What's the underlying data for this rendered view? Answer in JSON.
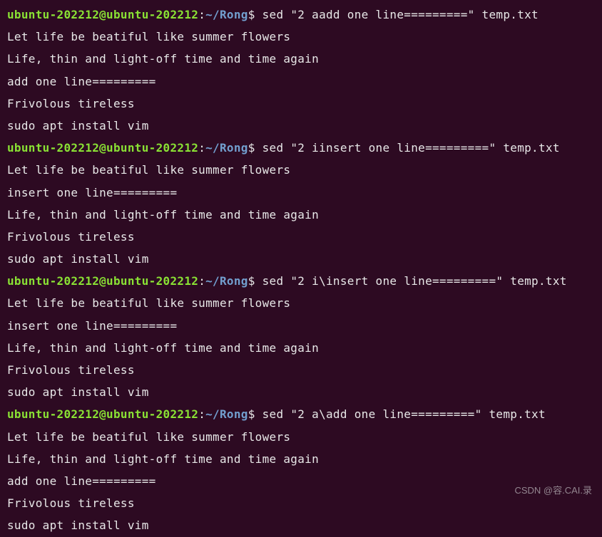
{
  "prompt": {
    "user_host": "ubuntu-202212@ubuntu-202212",
    "path": "~/Rong"
  },
  "blocks": [
    {
      "command": "sed \"2 aadd one line=========\" temp.txt",
      "output": [
        "Let life be beatiful like summer flowers",
        "Life, thin and light-off time and time again",
        "add one line=========",
        "Frivolous tireless",
        "sudo apt install vim"
      ]
    },
    {
      "command": "sed \"2 iinsert one line=========\" temp.txt",
      "output": [
        "Let life be beatiful like summer flowers",
        "insert one line=========",
        "Life, thin and light-off time and time again",
        "Frivolous tireless",
        "sudo apt install vim"
      ]
    },
    {
      "command": "sed \"2 i\\insert one line=========\" temp.txt",
      "output": [
        "Let life be beatiful like summer flowers",
        "insert one line=========",
        "Life, thin and light-off time and time again",
        "Frivolous tireless",
        "sudo apt install vim"
      ]
    },
    {
      "command": "sed \"2 a\\add one line=========\" temp.txt",
      "output": [
        "Let life be beatiful like summer flowers",
        "Life, thin and light-off time and time again",
        "add one line=========",
        "Frivolous tireless",
        "sudo apt install vim"
      ]
    }
  ],
  "watermark": "CSDN @容.CAI.录"
}
